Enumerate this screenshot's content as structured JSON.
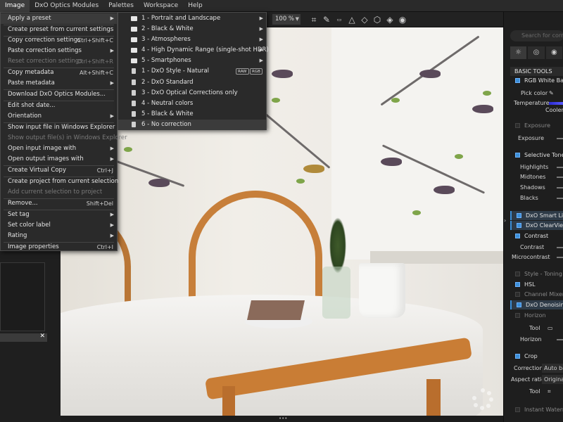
{
  "menubar": [
    "Image",
    "DxO Optics Modules",
    "Palettes",
    "Workspace",
    "Help"
  ],
  "main_menu": [
    {
      "label": "Apply a preset",
      "shortcut": "",
      "submenu": true,
      "disabled": false,
      "hover": true
    },
    {
      "label": "Create preset from current settings",
      "shortcut": "",
      "submenu": false,
      "disabled": false
    },
    {
      "label": "Copy correction settings",
      "shortcut": "Ctrl+Shift+C",
      "submenu": false,
      "disabled": false
    },
    {
      "label": "Paste correction settings",
      "shortcut": "",
      "submenu": true,
      "disabled": false
    },
    {
      "label": "Reset correction settings",
      "shortcut": "Ctrl+Shift+R",
      "submenu": false,
      "disabled": true
    },
    {
      "label": "Copy metadata",
      "shortcut": "Alt+Shift+C",
      "submenu": false,
      "disabled": false
    },
    {
      "label": "Paste metadata",
      "shortcut": "",
      "submenu": true,
      "disabled": false
    },
    {
      "label": "Download DxO Optics Modules...",
      "shortcut": "",
      "submenu": false,
      "disabled": false
    },
    {
      "label": "Edit shot date...",
      "shortcut": "",
      "submenu": false,
      "disabled": false
    },
    {
      "label": "Orientation",
      "shortcut": "",
      "submenu": true,
      "disabled": false
    },
    {
      "label": "Show input file in Windows Explorer",
      "shortcut": "",
      "submenu": false,
      "disabled": false
    },
    {
      "label": "Show output file(s) in Windows Explorer",
      "shortcut": "",
      "submenu": false,
      "disabled": true
    },
    {
      "label": "Open input image with",
      "shortcut": "",
      "submenu": true,
      "disabled": false
    },
    {
      "label": "Open output images with",
      "shortcut": "",
      "submenu": true,
      "disabled": false
    },
    {
      "label": "Create Virtual Copy",
      "shortcut": "Ctrl+J",
      "submenu": false,
      "disabled": false
    },
    {
      "label": "Create project from current selection",
      "shortcut": "",
      "submenu": false,
      "disabled": false
    },
    {
      "label": "Add current selection to project",
      "shortcut": "",
      "submenu": false,
      "disabled": true
    },
    {
      "label": "Remove...",
      "shortcut": "Shift+Del",
      "submenu": false,
      "disabled": false
    },
    {
      "label": "Set tag",
      "shortcut": "",
      "submenu": true,
      "disabled": false
    },
    {
      "label": "Set color label",
      "shortcut": "",
      "submenu": true,
      "disabled": false
    },
    {
      "label": "Rating",
      "shortcut": "",
      "submenu": true,
      "disabled": false
    },
    {
      "label": "Image properties",
      "shortcut": "Ctrl+I",
      "submenu": false,
      "disabled": false
    }
  ],
  "preset_submenu": [
    {
      "label": "1 - Portrait and Landscape",
      "icon": "folder-icon",
      "submenu": true
    },
    {
      "label": "2 - Black & White",
      "icon": "folder-icon",
      "submenu": true
    },
    {
      "label": "3 - Atmospheres",
      "icon": "folder-icon",
      "submenu": true
    },
    {
      "label": "4 - High Dynamic Range (single-shot HDR)",
      "icon": "folder-icon",
      "submenu": true
    },
    {
      "label": "5 - Smartphones",
      "icon": "folder-icon",
      "submenu": true
    },
    {
      "label": "1 - DxO Style - Natural",
      "icon": "preset-file-icon",
      "badges": [
        "RAW",
        "RGB"
      ]
    },
    {
      "label": "2 - DxO Standard",
      "icon": "preset-file-icon"
    },
    {
      "label": "3 - DxO Optical Corrections only",
      "icon": "preset-file-icon"
    },
    {
      "label": "4 - Neutral colors",
      "icon": "preset-file-icon"
    },
    {
      "label": "5 - Black & White",
      "icon": "preset-file-icon"
    },
    {
      "label": "6 - No correction",
      "icon": "preset-file-icon",
      "hover": true
    }
  ],
  "toolbar": {
    "zoom": "100 %",
    "icons": [
      "crop-icon",
      "eyedropper-icon",
      "horizon-icon",
      "perspective-icon",
      "perspective-rect-icon",
      "local-adjust-icon",
      "repair-icon",
      "preview-eye-icon"
    ]
  },
  "right_panel": {
    "search_placeholder": "Search for corr",
    "tabs": [
      "light-tab-icon",
      "color-tab-icon",
      "detail-tab-icon"
    ],
    "basic_tools": "BASIC TOOLS",
    "rgb_white_balance": "RGB White Bala",
    "pick_color": "Pick color",
    "temperature": "Temperature",
    "cooler": "Cooler",
    "exposure_section": "Exposure",
    "exposure": "Exposure",
    "selective_tone": "Selective Tone",
    "highlights": "Highlights",
    "midtones": "Midtones",
    "shadows": "Shadows",
    "blacks": "Blacks",
    "smart_lighting": "DxO Smart Ligh",
    "clearview": "DxO ClearView",
    "contrast_section": "Contrast",
    "contrast": "Contrast",
    "microcontrast": "Microcontrast",
    "style_toning": "Style - Toning",
    "hsl": "HSL",
    "channel_mixer": "Channel Mixer",
    "denoising": "DxO Denoising",
    "horizon_section": "Horizon",
    "tool": "Tool",
    "horizon": "Horizon",
    "crop_section": "Crop",
    "correction": "Correction",
    "correction_value": "Auto ba",
    "aspect_ratio": "Aspect ratio",
    "aspect_value": "Original",
    "crop_tool": "Tool",
    "instant_watermark": "Instant Waterm"
  },
  "colors": {
    "accent": "#3b8fd9",
    "menu_bg": "#2a2a2a",
    "menu_hover": "#3b3b3b",
    "chair_wood": "#c77f3a"
  }
}
